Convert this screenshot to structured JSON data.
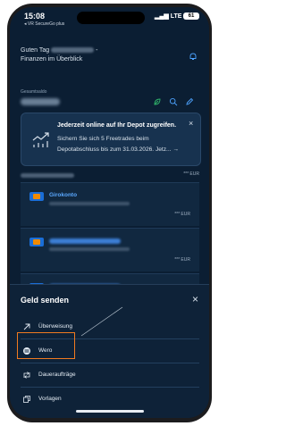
{
  "status": {
    "time": "15:08",
    "back_app": "◂ VR SecureGo plus",
    "network": "LTE",
    "battery": "61"
  },
  "header": {
    "greeting": "Guten Tag",
    "subtitle": "Finanzen im Überblick"
  },
  "overview": {
    "label": "Gesamtsaldo"
  },
  "banner": {
    "title": "Jederzeit online auf Ihr Depot zugreifen.",
    "text": "Sichern Sie sich 5 Freetrades beim Depotabschluss bis zum 31.03.2026. Jetz...",
    "arrow": "→",
    "close": "×"
  },
  "total_currency": "*** EUR",
  "accounts": [
    {
      "name": "Girokonto",
      "amount": "*** EUR"
    },
    {
      "name": "",
      "amount": "*** EUR"
    },
    {
      "name": "",
      "amount": ""
    }
  ],
  "sheet": {
    "title": "Geld senden",
    "close": "×",
    "items": [
      {
        "label": "Überweisung",
        "icon": "arrow-up-right-icon"
      },
      {
        "label": "Wero",
        "icon": "wero-icon"
      },
      {
        "label": "Daueraufträge",
        "icon": "repeat-icon"
      },
      {
        "label": "Vorlagen",
        "icon": "copy-icon"
      }
    ]
  },
  "colors": {
    "background": "#0b1e33",
    "accent": "#5aa8ff",
    "highlight": "#f07a20",
    "leaf": "#2fb36a"
  }
}
